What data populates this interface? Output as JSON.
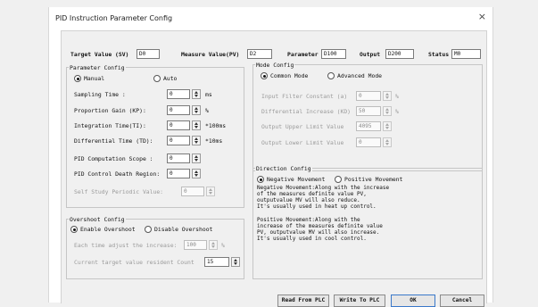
{
  "window": {
    "title": "PID Instruction Parameter Config",
    "close_glyph": "×"
  },
  "top_row": {
    "target_value_label": "Target Value (SV)",
    "target_value": "D0",
    "measure_value_label": "Measure Value(PV)",
    "measure_value": "D2",
    "parameter_label": "Parameter",
    "parameter": "D100",
    "output_label": "Output",
    "output": "D200",
    "status_label": "Status",
    "status": "M0"
  },
  "parameter_config": {
    "title": "Parameter Config",
    "manual_label": "Manual",
    "auto_label": "Auto",
    "sampling_time_label": "Sampling Time :",
    "sampling_time": "0",
    "sampling_time_unit": "ms",
    "proportion_gain_label": "Proportion Gain (KP):",
    "proportion_gain": "0",
    "proportion_gain_unit": "%",
    "integration_time_label": "Integration Time(TI):",
    "integration_time": "0",
    "integration_time_unit": "*100ms",
    "differential_time_label": "Differential Time (TD):",
    "differential_time": "0",
    "differential_time_unit": "*10ms",
    "computation_scope_label": "PID Computation Scope :",
    "computation_scope": "0",
    "death_region_label": "PID Control Death Region:",
    "death_region": "0",
    "self_study_label": "Self Study Periodic Value:",
    "self_study": "0"
  },
  "overshoot_config": {
    "title": "Overshoot Config",
    "enable_label": "Enable Overshoot",
    "disable_label": "Disable Overshoot",
    "adjust_label": "Each time adjust the increase:",
    "adjust_value": "100",
    "adjust_unit": "%",
    "resident_label": "Current target value resident Count",
    "resident_value": "15"
  },
  "mode_config": {
    "title": "Mode Config",
    "common_label": "Common Mode",
    "advanced_label": "Advanced Mode",
    "filter_label": "Input Filter Constant (a)",
    "filter_value": "0",
    "filter_unit": "%",
    "diff_increase_label": "Differential Increase (KD)",
    "diff_increase_value": "50",
    "diff_increase_unit": "%",
    "upper_limit_label": "Output Upper Limit Value",
    "upper_limit_value": "4095",
    "lower_limit_label": "Output Lower Limit Value",
    "lower_limit_value": "0"
  },
  "direction_config": {
    "title": "Direction Config",
    "negative_label": "Negative Movement",
    "positive_label": "Positive Movement",
    "negative_desc_1": "Negative Movement:Along with  the increase",
    "negative_desc_2": "of the measures definite value PV,",
    "negative_desc_3": "outputvalue MV will also reduce.",
    "negative_desc_4": "It's usually used in heat up control.",
    "positive_desc_1": "Positive Movement:Along with  the",
    "positive_desc_2": "increase of the measures definite value",
    "positive_desc_3": "PV, outputvalue MV will also increase.",
    "positive_desc_4": "It's usually used in cool control."
  },
  "buttons": {
    "read_plc": "Read From PLC",
    "write_plc": "Write To PLC",
    "ok": "OK",
    "cancel": "Cancel"
  },
  "colors": {
    "default_button_border": "#3a78c9",
    "field_border": "#7a7a7a",
    "disabled_text": "#9a9a9a"
  }
}
